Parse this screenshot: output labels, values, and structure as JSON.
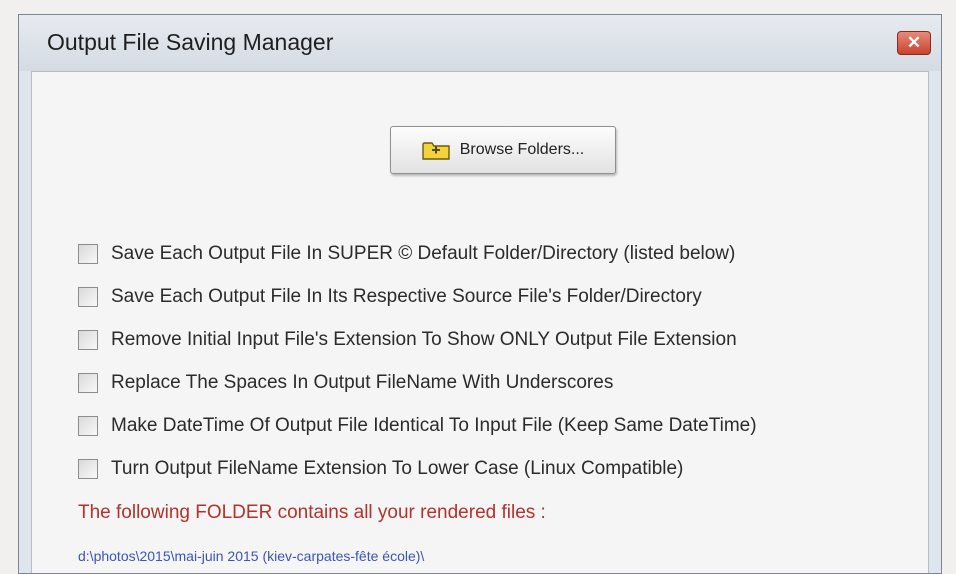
{
  "window": {
    "title": "Output File Saving Manager",
    "close_icon": "close-icon",
    "close_glyph": "✕",
    "close_color": "#d9533c"
  },
  "browse": {
    "label": "Browse Folders...",
    "icon": "folder-icon"
  },
  "options": [
    {
      "label": "Save Each Output File In  SUPER ©  Default Folder/Directory  (listed below)",
      "checked": false
    },
    {
      "label": "Save Each Output File In Its Respective Source File's Folder/Directory",
      "checked": false
    },
    {
      "label": "Remove Initial Input File's Extension To Show ONLY Output File Extension",
      "checked": false
    },
    {
      "label": "Replace The Spaces In Output FileName With Underscores",
      "checked": false
    },
    {
      "label": "Make DateTime Of Output File Identical To Input File (Keep Same DateTime)",
      "checked": false
    },
    {
      "label": "Turn Output FileName Extension To Lower Case (Linux Compatible)",
      "checked": false
    }
  ],
  "folder": {
    "heading": "The following FOLDER contains all your rendered files :",
    "heading_color": "#b3322b",
    "path": "d:\\photos\\2015\\mai-juin 2015 (kiev-carpates-fête école)\\",
    "path_color": "#3a55b8"
  }
}
